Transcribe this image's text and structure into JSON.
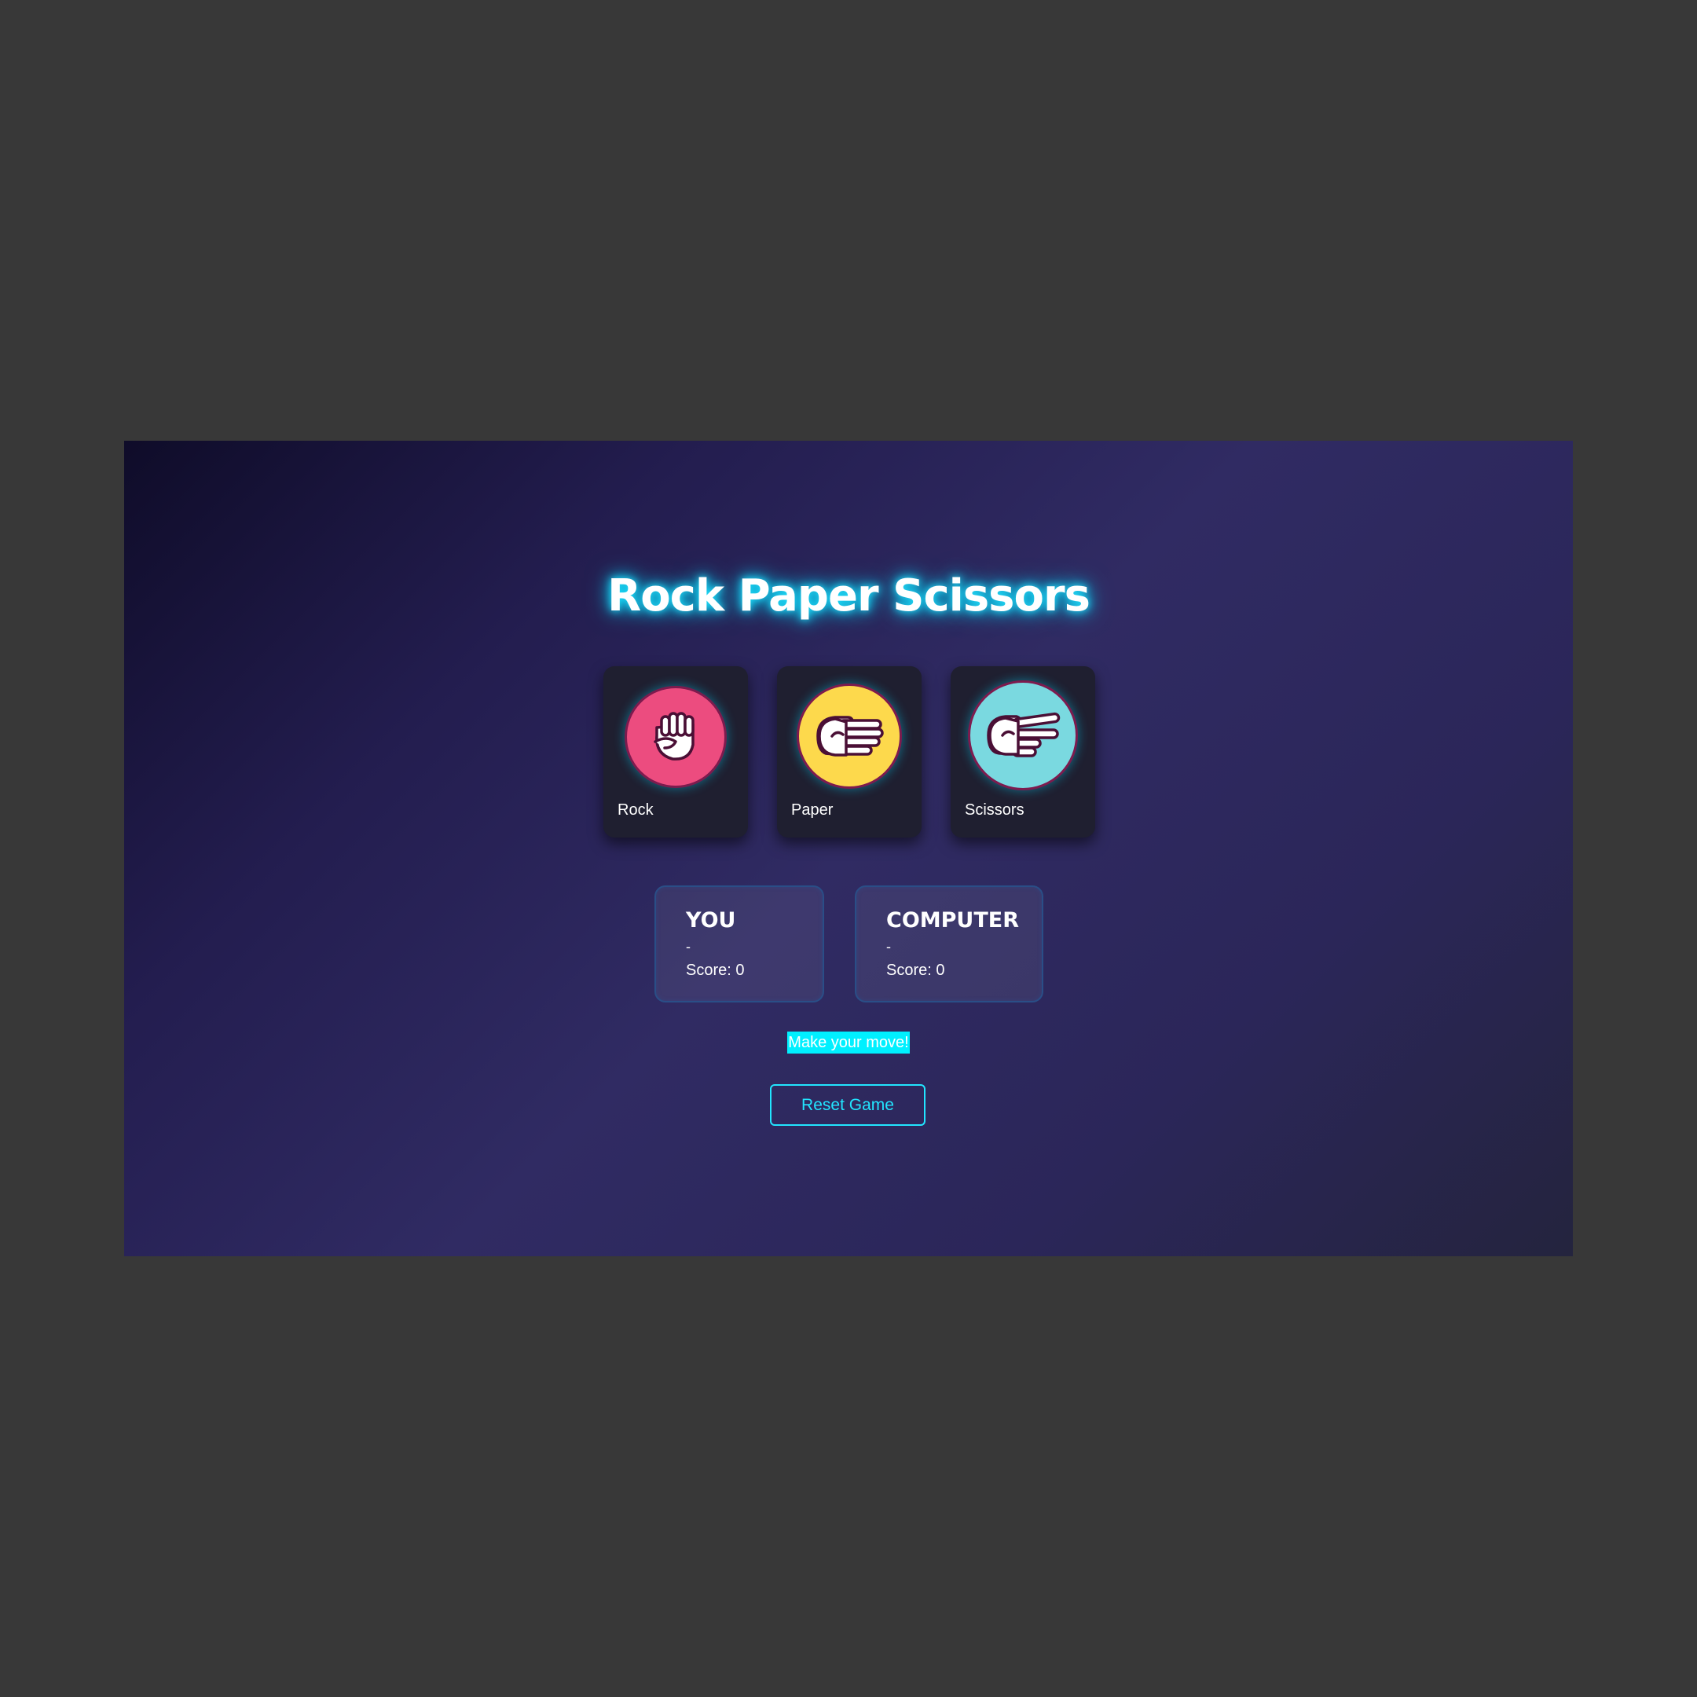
{
  "game": {
    "title": "Rock Paper Scissors",
    "choices": [
      {
        "id": "rock",
        "label": "Rock",
        "icon": "fist-icon",
        "color": "#ec4c7f"
      },
      {
        "id": "paper",
        "label": "Paper",
        "icon": "open-hand-icon",
        "color": "#fdd94c"
      },
      {
        "id": "scissors",
        "label": "Scissors",
        "icon": "two-fingers-icon",
        "color": "#7ad9e0"
      }
    ],
    "scoreboard": {
      "player": {
        "name": "YOU",
        "choice": "-",
        "score_text": "Score: 0"
      },
      "computer": {
        "name": "COMPUTER",
        "choice": "-",
        "score_text": "Score: 0"
      }
    },
    "status": "Make your move!",
    "reset_label": "Reset Game"
  },
  "colors": {
    "background": "#302b63",
    "accent": "#22e5ff",
    "card": "#1f1f30",
    "icon_outline": "#7d1b4e"
  }
}
